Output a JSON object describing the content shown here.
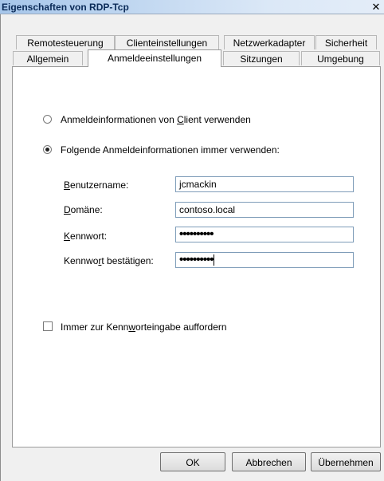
{
  "window": {
    "title": "Eigenschaften von RDP-Tcp",
    "close_glyph": "✕"
  },
  "tabs_row1": [
    {
      "label": "Remotesteuerung"
    },
    {
      "label": "Clienteinstellungen"
    },
    {
      "label": "Netzwerkadapter"
    },
    {
      "label": "Sicherheit"
    }
  ],
  "tabs_row2": [
    {
      "label": "Allgemein"
    },
    {
      "label": "Anmeldeeinstellungen",
      "active": true
    },
    {
      "label": "Sitzungen"
    },
    {
      "label": "Umgebung"
    }
  ],
  "options": {
    "use_client": {
      "pre": "Anmeldeinformationen von ",
      "hot": "C",
      "post": "lient verwenden",
      "checked": false
    },
    "always_use": {
      "pre": "Fol",
      "hot": "g",
      "post": "ende Anmeldeinformationen immer verwenden:",
      "checked": true
    }
  },
  "fields": {
    "username": {
      "hot": "B",
      "rest": "enutzername:",
      "value": "jcmackin"
    },
    "domain": {
      "hot": "D",
      "rest": "omäne:",
      "value": "contoso.local"
    },
    "password": {
      "hot": "K",
      "rest": "ennwort:",
      "value": "••••••••••"
    },
    "confirm": {
      "pre": "Kennwo",
      "hot": "r",
      "post": "t bestätigen:",
      "value": "••••••••••"
    }
  },
  "prompt_checkbox": {
    "pre": "Immer zur Kenn",
    "hot": "w",
    "post": "orteingabe auffordern",
    "checked": false
  },
  "buttons": {
    "ok": "OK",
    "cancel": "Abbrechen",
    "apply": "Übernehmen"
  }
}
